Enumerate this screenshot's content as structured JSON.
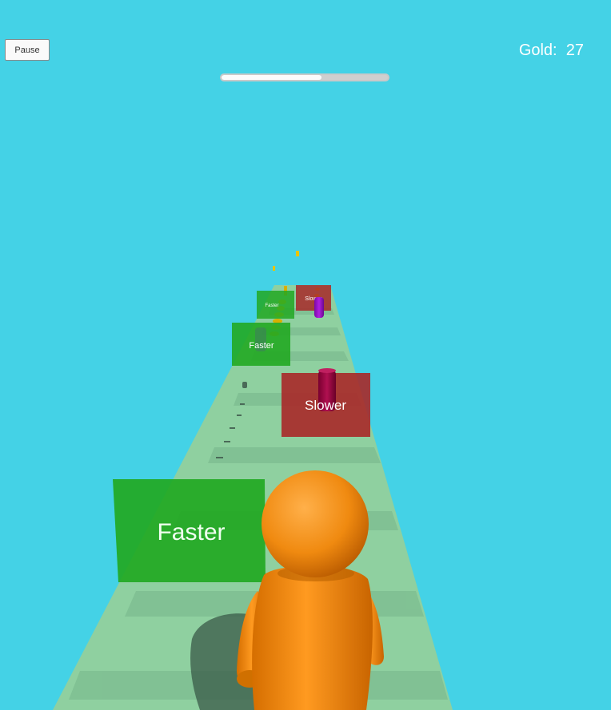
{
  "hud": {
    "pause_label": "Pause",
    "gold_label": "Gold:",
    "gold_value": "27",
    "level_progress": 0.6
  },
  "gates": [
    {
      "label": "Faster",
      "type": "faster",
      "color": "#22a822"
    },
    {
      "label": "Slower",
      "type": "slower",
      "color": "#a82828"
    },
    {
      "label": "Faster",
      "type": "faster",
      "color": "#22a822"
    },
    {
      "label": "Faster",
      "type": "faster",
      "color": "#22a822"
    },
    {
      "label": "Slower",
      "type": "slower",
      "color": "#a82828"
    }
  ],
  "colors": {
    "sky": "#44d2e6",
    "track": "#8fd0a0",
    "player": "#f08a10",
    "coin": "#e8c400",
    "obstacle": "#9a10c8"
  }
}
